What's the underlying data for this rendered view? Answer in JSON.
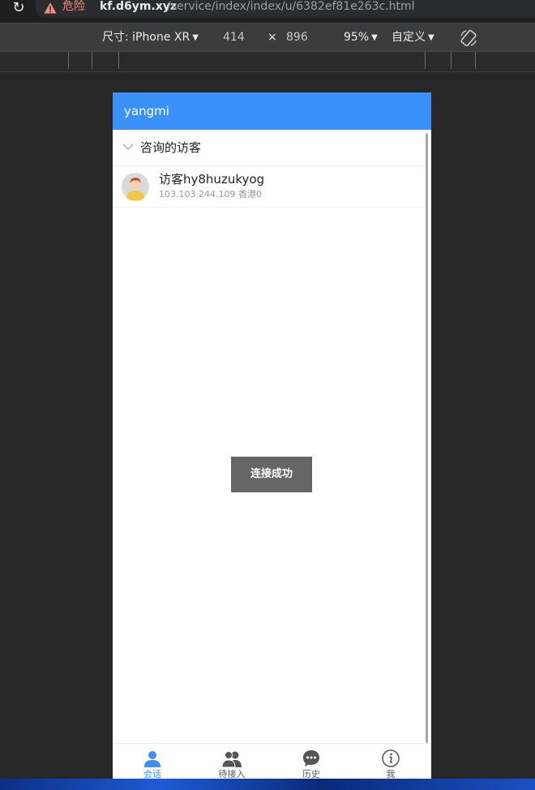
{
  "browser": {
    "danger_label": "危险",
    "url_host": "kf.d6ym.xyz",
    "url_path": "/service/index/index/u/6382ef81e263c.html"
  },
  "devtools": {
    "device_label": "尺寸: iPhone XR",
    "width": "414",
    "times": "×",
    "height": "896",
    "zoom": "95%",
    "throttle": "自定义"
  },
  "app": {
    "title": "yangmi",
    "group_label": "咨询的访客",
    "visitor": {
      "name": "访客hy8huzukyog",
      "meta": "103.103.244.109 香港0"
    },
    "toast": "连接成功",
    "tabs": [
      {
        "label": "会话",
        "icon": "user-icon",
        "active": true
      },
      {
        "label": "待接入",
        "icon": "users-icon",
        "active": false
      },
      {
        "label": "历史",
        "icon": "chat-bubble-icon",
        "active": false
      },
      {
        "label": "我",
        "icon": "info-icon",
        "active": false
      }
    ]
  },
  "colors": {
    "header_blue": "#3b91fb",
    "toast_bg": "#666666",
    "danger": "#f28b82"
  }
}
